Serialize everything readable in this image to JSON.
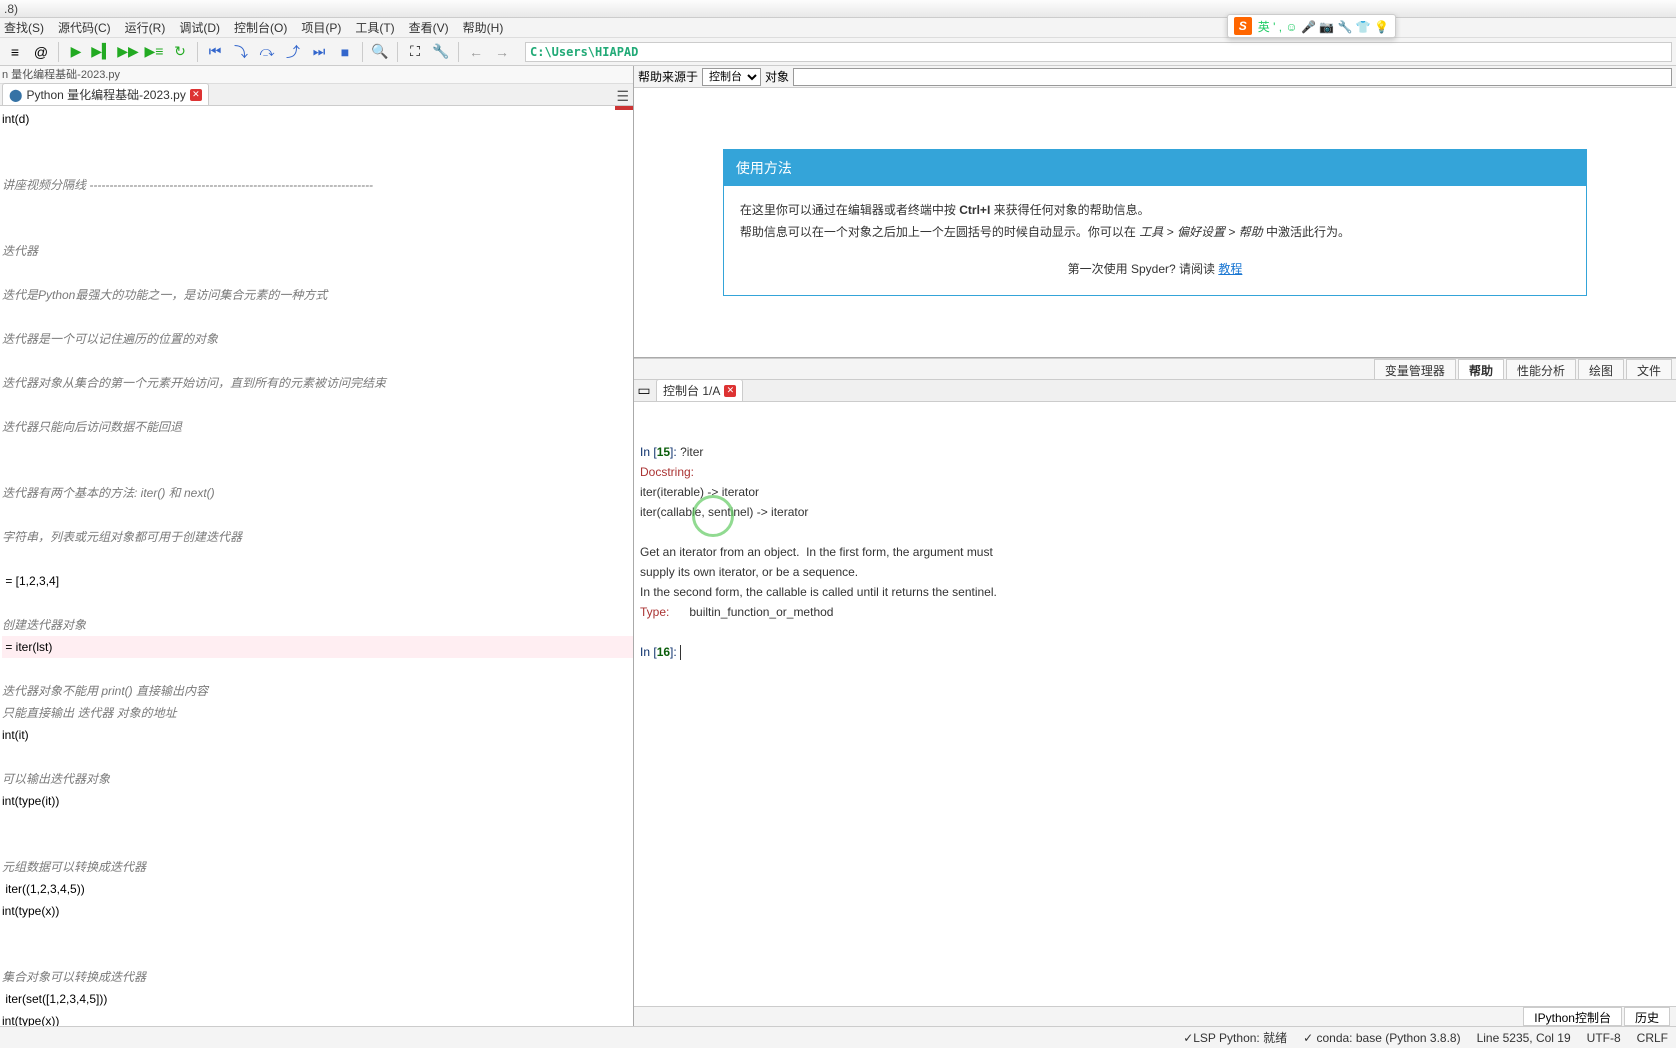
{
  "title": ".8)",
  "menu": [
    "查找(S)",
    "源代码(C)",
    "运行(R)",
    "调试(D)",
    "控制台(O)",
    "项目(P)",
    "工具(T)",
    "查看(V)",
    "帮助(H)"
  ],
  "path": "C:\\Users\\HIAPAD",
  "breadcrumb": "n 量化编程基础-2023.py",
  "tabName": "Python 量化编程基础-2023.py",
  "editor": {
    "l1": "int(d)",
    "l2": "讲座视频分隔线 -----------------------------------------------------------------------",
    "l3": "迭代器",
    "l4": "迭代是Python最强大的功能之一，是访问集合元素的一种方式",
    "l5": "迭代器是一个可以记住遍历的位置的对象",
    "l6": "迭代器对象从集合的第一个元素开始访问，直到所有的元素被访问完结束",
    "l7": "迭代器只能向后访问数据不能回退",
    "l8": "迭代器有两个基本的方法: iter() 和 next()",
    "l9": "字符串，列表或元组对象都可用于创建迭代器",
    "l10": " = [1,2,3,4]",
    "l11": "创建迭代器对象",
    "l12": " = iter(lst)",
    "l13": "迭代器对象不能用 print() 直接输出内容",
    "l14": "只能直接输出 迭代器 对象的地址",
    "l15": "int(it)",
    "l16": "可以输出迭代器对象",
    "l17": "int(type(it))",
    "l18": "元组数据可以转换成迭代器",
    "l19": " iter((1,2,3,4,5))",
    "l20": "int(type(x))",
    "l21": "集合对象可以转换成迭代器",
    "l22": " iter(set([1,2,3,4,5]))",
    "l23": "int(type(x))"
  },
  "help": {
    "srcLabel": "帮助来源于",
    "srcCombo": "控制台",
    "objLabel": "对象",
    "title": "使用方法",
    "p1a": "在这里你可以通过在编辑器或者终端中按 ",
    "p1k": "Ctrl+I",
    "p1b": " 来获得任何对象的帮助信息。",
    "p2a": "帮助信息可以在一个对象之后加上一个左圆括号的时候自动显示。你可以在 ",
    "p2i": "工具 > 偏好设置 > 帮助",
    "p2b": " 中激活此行为。",
    "p3a": "第一次使用 Spyder? 请阅读 ",
    "p3link": "教程",
    "tabs": [
      "变量管理器",
      "帮助",
      "性能分析",
      "绘图",
      "文件"
    ]
  },
  "consoleTab": "控制台 1/A",
  "console": {
    "in15p": "In [",
    "in15n": "15",
    "in15s": "]: ",
    "in15c": "?iter",
    "doc": "Docstring:",
    "sig1": "iter(iterable) -> iterator",
    "sig2": "iter(callable, sentinel) -> iterator",
    "body1": "Get an iterator from an object.  In the first form, the argument must",
    "body2": "supply its own iterator, or be a sequence.",
    "body3": "In the second form, the callable is called until it returns the sentinel.",
    "typeK": "Type:",
    "typeV": "      builtin_function_or_method",
    "in16p": "In [",
    "in16n": "16",
    "in16s": "]: "
  },
  "consoleBottomTabs": [
    "IPython控制台",
    "历史"
  ],
  "status": {
    "lsp": "✓LSP Python: 就绪",
    "conda": "✓ conda: base (Python 3.8.8)",
    "line": "Line 5235, Col 19",
    "enc": "UTF-8",
    "eol": "CRLF"
  },
  "ime": "英 ' , ☺ 🎤 📷 🔧 👕 💡"
}
